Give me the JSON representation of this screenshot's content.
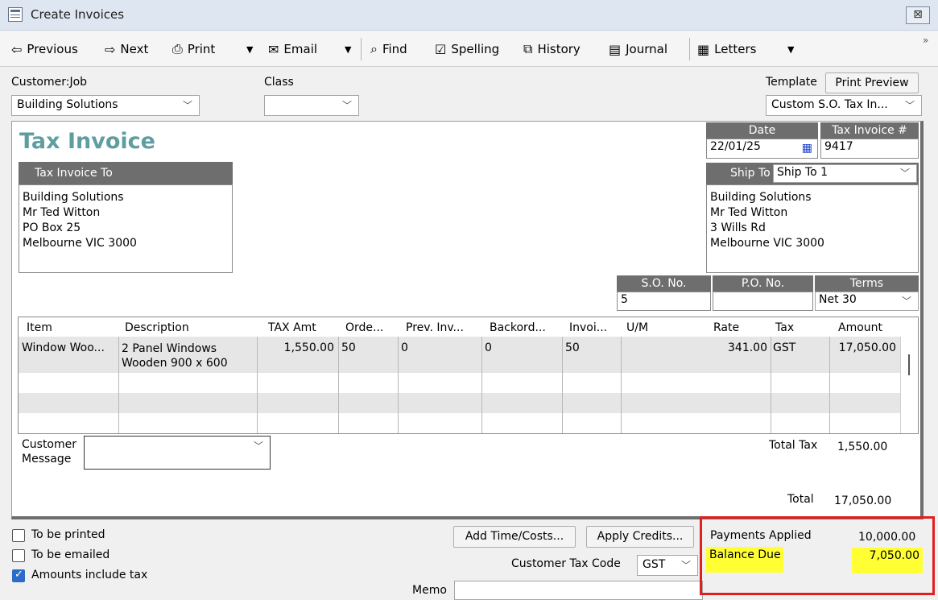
{
  "window": {
    "title": "Create Invoices",
    "close_label": "⊠"
  },
  "toolbar": {
    "previous": "Previous",
    "next": "Next",
    "print": "Print",
    "email": "Email",
    "find": "Find",
    "spelling": "Spelling",
    "history": "History",
    "journal": "Journal",
    "letters": "Letters",
    "overflow": "»"
  },
  "header": {
    "customer_job_label": "Customer:Job",
    "customer_job_value": "Building Solutions",
    "class_label": "Class",
    "class_value": "",
    "template_label": "Template",
    "print_preview": "Print Preview",
    "template_value": "Custom S.O. Tax In..."
  },
  "invoice": {
    "heading": "Tax Invoice",
    "bill_to_label": "Tax Invoice To",
    "bill_to_address": "Building Solutions\nMr Ted Witton\nPO Box 25\nMelbourne  VIC 3000",
    "date_label": "Date",
    "date_value": "22/01/25",
    "number_label": "Tax Invoice #",
    "number_value": "9417",
    "ship_to_label": "Ship To",
    "ship_to_value": "Ship To 1",
    "ship_to_address": "Building Solutions\nMr Ted Witton\n3 Wills Rd\nMelbourne  VIC 3000",
    "so_label": "S.O. No.",
    "so_value": "5",
    "po_label": "P.O. No.",
    "po_value": "",
    "terms_label": "Terms",
    "terms_value": "Net 30"
  },
  "grid": {
    "columns": [
      "Item",
      "Description",
      "TAX Amt",
      "Orde...",
      "Prev. Inv...",
      "Backord...",
      "Invoi...",
      "U/M",
      "Rate",
      "Tax",
      "Amount"
    ],
    "rows": [
      {
        "item": "Window Woo...",
        "description": "2 Panel Windows\nWooden 900 x 600",
        "tax_amt": "1,550.00",
        "ordered": "50",
        "prev_invoiced": "0",
        "backordered": "0",
        "invoiced": "50",
        "um": "",
        "rate": "341.00",
        "tax": "GST",
        "amount": "17,050.00"
      }
    ]
  },
  "footer": {
    "customer_message_label": "Customer\nMessage",
    "customer_message_value": "",
    "total_tax_label": "Total Tax",
    "total_tax_value": "1,550.00",
    "total_label": "Total",
    "total_value": "17,050.00",
    "to_be_printed": "To be printed",
    "to_be_printed_checked": false,
    "to_be_emailed": "To be emailed",
    "to_be_emailed_checked": false,
    "amounts_include_tax": "Amounts include tax",
    "amounts_include_tax_checked": true,
    "add_time_costs": "Add Time/Costs...",
    "apply_credits": "Apply Credits...",
    "customer_tax_code_label": "Customer Tax Code",
    "customer_tax_code_value": "GST",
    "memo_label": "Memo",
    "memo_value": "",
    "payments_applied_label": "Payments Applied",
    "payments_applied_value": "10,000.00",
    "balance_due_label": "Balance Due",
    "balance_due_value": "7,050.00"
  },
  "colors": {
    "heading": "#5f9ea0",
    "highlight": "#ffff33",
    "annotation_border": "#e02020"
  }
}
